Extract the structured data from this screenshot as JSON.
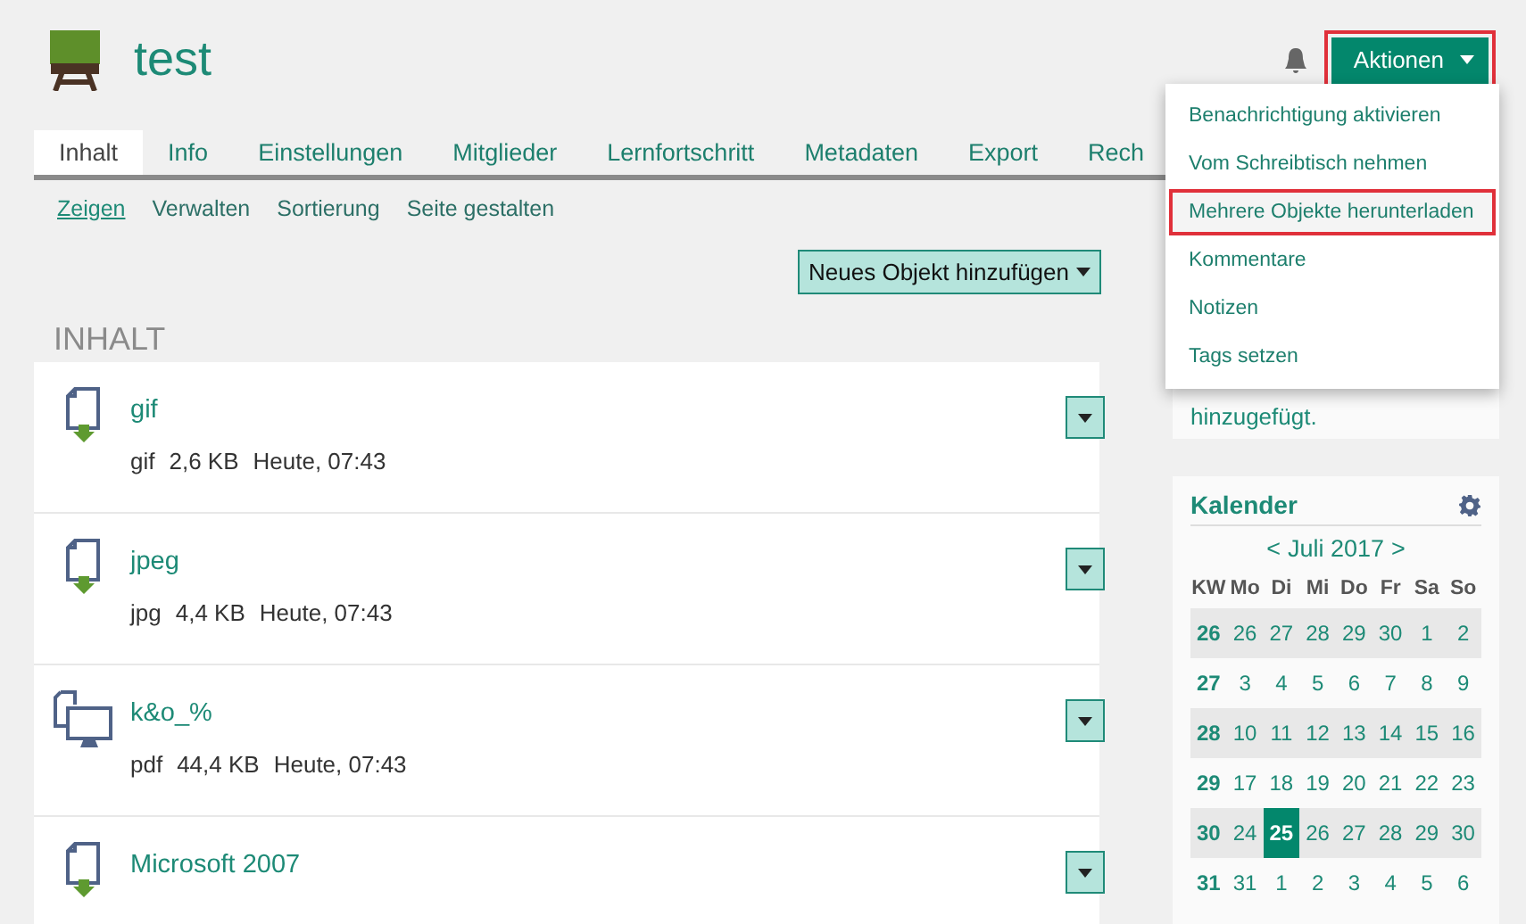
{
  "header": {
    "title": "test",
    "actions_button": {
      "label": "Aktionen",
      "highlighted": true
    }
  },
  "tabs": [
    {
      "label": "Inhalt",
      "selected": true
    },
    {
      "label": "Info",
      "selected": false
    },
    {
      "label": "Einstellungen",
      "selected": false
    },
    {
      "label": "Mitglieder",
      "selected": false
    },
    {
      "label": "Lernfortschritt",
      "selected": false
    },
    {
      "label": "Metadaten",
      "selected": false
    },
    {
      "label": "Export",
      "selected": false
    },
    {
      "label": "Rech",
      "selected": false
    }
  ],
  "subtabs": [
    {
      "label": "Zeigen",
      "selected": true
    },
    {
      "label": "Verwalten",
      "selected": false
    },
    {
      "label": "Sortierung",
      "selected": false
    },
    {
      "label": "Seite gestalten",
      "selected": false
    }
  ],
  "add_button": "Neues Objekt hinzufügen",
  "section_title": "INHALT",
  "items": [
    {
      "kind": "file",
      "title": "gif",
      "type": "gif",
      "size": "2,6 KB",
      "date": "Heute, 07:43"
    },
    {
      "kind": "file",
      "title": "jpeg",
      "type": "jpg",
      "size": "4,4 KB",
      "date": "Heute, 07:43"
    },
    {
      "kind": "presentation",
      "title": "k&o_%",
      "type": "pdf",
      "size": "44,4 KB",
      "date": "Heute, 07:43"
    },
    {
      "kind": "file",
      "title": "Microsoft 2007"
    }
  ],
  "actions_menu": [
    {
      "label": "Benachrichtigung aktivieren",
      "highlighted": false
    },
    {
      "label": "Vom Schreibtisch nehmen",
      "highlighted": false
    },
    {
      "label": "Mehrere Objekte herunterladen",
      "highlighted": true
    },
    {
      "label": "Kommentare",
      "highlighted": false
    },
    {
      "label": "Notizen",
      "highlighted": false
    },
    {
      "label": "Tags setzen",
      "highlighted": false
    }
  ],
  "news_text": "hinzugefügt.",
  "calendar": {
    "title": "Kalender",
    "prev": "<",
    "month": "Juli 2017",
    "next": ">",
    "headers": [
      "KW",
      "Mo",
      "Di",
      "Mi",
      "Do",
      "Fr",
      "Sa",
      "So"
    ],
    "weeks": [
      {
        "kw": "26",
        "days": [
          {
            "label": "26",
            "selected": false
          },
          {
            "label": "27",
            "selected": false
          },
          {
            "label": "28",
            "selected": false
          },
          {
            "label": "29",
            "selected": false
          },
          {
            "label": "30",
            "selected": false
          },
          {
            "label": "1",
            "selected": false
          },
          {
            "label": "2",
            "selected": false
          }
        ]
      },
      {
        "kw": "27",
        "days": [
          {
            "label": "3",
            "selected": false
          },
          {
            "label": "4",
            "selected": false
          },
          {
            "label": "5",
            "selected": false
          },
          {
            "label": "6",
            "selected": false
          },
          {
            "label": "7",
            "selected": false
          },
          {
            "label": "8",
            "selected": false
          },
          {
            "label": "9",
            "selected": false
          }
        ]
      },
      {
        "kw": "28",
        "days": [
          {
            "label": "10",
            "selected": false
          },
          {
            "label": "11",
            "selected": false
          },
          {
            "label": "12",
            "selected": false
          },
          {
            "label": "13",
            "selected": false
          },
          {
            "label": "14",
            "selected": false
          },
          {
            "label": "15",
            "selected": false
          },
          {
            "label": "16",
            "selected": false
          }
        ]
      },
      {
        "kw": "29",
        "days": [
          {
            "label": "17",
            "selected": false
          },
          {
            "label": "18",
            "selected": false
          },
          {
            "label": "19",
            "selected": false
          },
          {
            "label": "20",
            "selected": false
          },
          {
            "label": "21",
            "selected": false
          },
          {
            "label": "22",
            "selected": false
          },
          {
            "label": "23",
            "selected": false
          }
        ]
      },
      {
        "kw": "30",
        "days": [
          {
            "label": "24",
            "selected": false
          },
          {
            "label": "25",
            "selected": true
          },
          {
            "label": "26",
            "selected": false
          },
          {
            "label": "27",
            "selected": false
          },
          {
            "label": "28",
            "selected": false
          },
          {
            "label": "29",
            "selected": false
          },
          {
            "label": "30",
            "selected": false
          }
        ]
      },
      {
        "kw": "31",
        "days": [
          {
            "label": "31",
            "selected": false
          },
          {
            "label": "1",
            "selected": false
          },
          {
            "label": "2",
            "selected": false
          },
          {
            "label": "3",
            "selected": false
          },
          {
            "label": "4",
            "selected": false
          },
          {
            "label": "5",
            "selected": false
          },
          {
            "label": "6",
            "selected": false
          }
        ]
      }
    ]
  }
}
